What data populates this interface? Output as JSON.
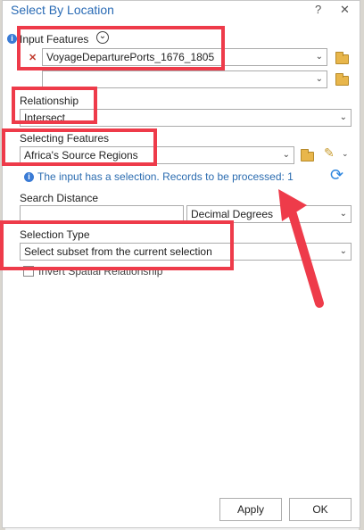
{
  "window": {
    "title": "Select By Location",
    "help": "?",
    "close": "✕"
  },
  "input_features": {
    "label": "Input Features",
    "expand_glyph": "⌄",
    "remove_glyph": "✕",
    "value": "VoyageDeparturePorts_1676_1805",
    "empty_value": ""
  },
  "relationship": {
    "label": "Relationship",
    "value": "Intersect"
  },
  "selecting_features": {
    "label": "Selecting Features",
    "value": "Africa's Source Regions",
    "info_text": "The input has a selection. Records to be processed: 1"
  },
  "search_distance": {
    "label": "Search Distance",
    "value": "",
    "unit": "Decimal Degrees"
  },
  "selection_type": {
    "label": "Selection Type",
    "value": "Select subset from the current selection"
  },
  "invert": {
    "label": "Invert Spatial Relationship",
    "checked": false
  },
  "buttons": {
    "apply": "Apply",
    "ok": "OK"
  },
  "colors": {
    "annotation_red": "#ee3b4a",
    "title_blue": "#2a6bb5",
    "info_blue": "#2b6cb0"
  },
  "icons": [
    "info-icon",
    "expand-icon",
    "remove-icon",
    "chevron-down-icon",
    "folder-icon",
    "pencil-icon",
    "refresh-icon",
    "close-icon",
    "help-icon",
    "arrow-annotation"
  ]
}
